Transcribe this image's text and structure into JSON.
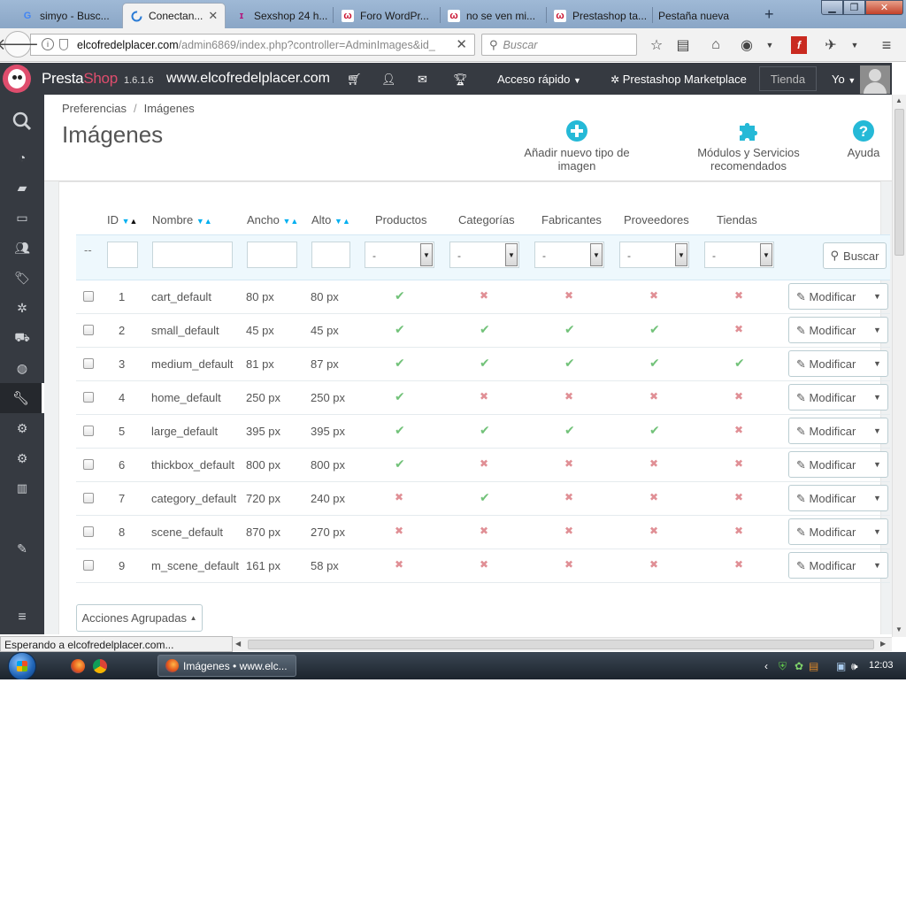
{
  "browser": {
    "tabs": [
      {
        "label": "simyo - Busc...",
        "icon": "google-icon"
      },
      {
        "label": "Conectan...",
        "icon": "loading-icon",
        "active": true
      },
      {
        "label": "Sexshop 24 h...",
        "icon": "figure-icon"
      },
      {
        "label": "Foro WordPr...",
        "icon": "w-icon"
      },
      {
        "label": "no se ven mi...",
        "icon": "w-icon"
      },
      {
        "label": "Prestashop ta...",
        "icon": "w-icon"
      },
      {
        "label": "Pestaña nueva",
        "icon": ""
      }
    ],
    "url_host": "elcofredelplacer.com",
    "url_path": "/admin6869/index.php?controller=AdminImages&id_",
    "search_placeholder": "Buscar"
  },
  "header": {
    "brand_presta": "Presta",
    "brand_shop": "Shop",
    "version": "1.6.1.6",
    "shop_name": "www.elcofredelplacer.com",
    "quick_access": "Acceso rápido",
    "marketplace": "Prestashop Marketplace",
    "store_button": "Tienda",
    "user_menu": "Yo"
  },
  "toolbar": {
    "breadcrumb_parent": "Preferencias",
    "breadcrumb_current": "Imágenes",
    "title": "Imágenes",
    "add_button": "Añadir nuevo tipo de imagen",
    "modules_button": "Módulos y Servicios recomendados",
    "help_button": "Ayuda"
  },
  "table": {
    "columns": [
      "ID",
      "Nombre",
      "Ancho",
      "Alto",
      "Productos",
      "Categorías",
      "Fabricantes",
      "Proveedores",
      "Tiendas"
    ],
    "filter_select_value": "-",
    "filter_dashes": "--",
    "search_button": "Buscar",
    "edit_label": "Modificar",
    "bulk_actions": "Acciones Agrupadas",
    "rows": [
      {
        "id": "1",
        "name": "cart_default",
        "width": "80 px",
        "height": "80 px",
        "flags": [
          true,
          false,
          false,
          false,
          false
        ]
      },
      {
        "id": "2",
        "name": "small_default",
        "width": "45 px",
        "height": "45 px",
        "flags": [
          true,
          true,
          true,
          true,
          false
        ]
      },
      {
        "id": "3",
        "name": "medium_default",
        "width": "81 px",
        "height": "87 px",
        "flags": [
          true,
          true,
          true,
          true,
          true
        ]
      },
      {
        "id": "4",
        "name": "home_default",
        "width": "250 px",
        "height": "250 px",
        "flags": [
          true,
          false,
          false,
          false,
          false
        ]
      },
      {
        "id": "5",
        "name": "large_default",
        "width": "395 px",
        "height": "395 px",
        "flags": [
          true,
          true,
          true,
          true,
          false
        ]
      },
      {
        "id": "6",
        "name": "thickbox_default",
        "width": "800 px",
        "height": "800 px",
        "flags": [
          true,
          false,
          false,
          false,
          false
        ]
      },
      {
        "id": "7",
        "name": "category_default",
        "width": "720 px",
        "height": "240 px",
        "flags": [
          false,
          true,
          false,
          false,
          false
        ]
      },
      {
        "id": "8",
        "name": "scene_default",
        "width": "870 px",
        "height": "270 px",
        "flags": [
          false,
          false,
          false,
          false,
          false
        ]
      },
      {
        "id": "9",
        "name": "m_scene_default",
        "width": "161 px",
        "height": "58 px",
        "flags": [
          false,
          false,
          false,
          false,
          false
        ]
      }
    ]
  },
  "status": {
    "text": "Esperando a elcofredelplacer.com..."
  },
  "taskbar": {
    "window_label": "Imágenes • www.elc...",
    "time": "12:03"
  },
  "colors": {
    "header_bg": "#363a41",
    "brand_pink": "#df4d6d",
    "accent_blue": "#25b9d7",
    "yes_green": "#72c279",
    "no_red": "#e08f95"
  }
}
